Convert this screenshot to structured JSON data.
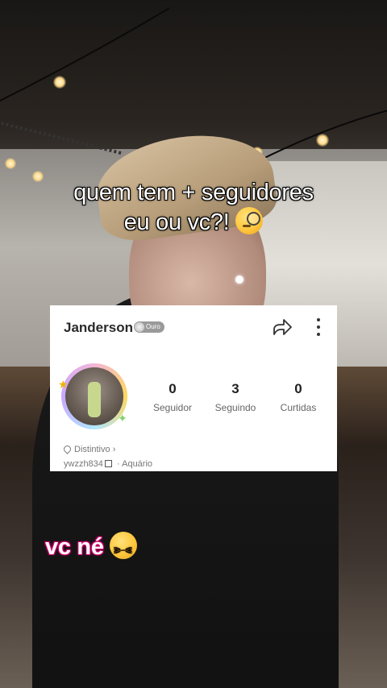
{
  "overlay": {
    "caption_top_line1": "quem tem + seguidores",
    "caption_top_line2": "eu ou vc?!",
    "caption_bottom": "vc né"
  },
  "profile": {
    "name": "Janderson",
    "badge_label": "Ouro",
    "stats": [
      {
        "value": "0",
        "label": "Seguidor"
      },
      {
        "value": "3",
        "label": "Seguindo"
      },
      {
        "value": "0",
        "label": "Curtidas"
      }
    ],
    "distintivo_label": "Distintivo",
    "distintivo_chevron": "›",
    "username": "ywzzh834",
    "separator": "·",
    "zodiac": "Aquário"
  },
  "icons": {
    "share": "share-arrow-icon",
    "more": "more-vertical-icon",
    "distintivo": "badge-pin-icon",
    "edit": "edit-icon",
    "emoji_top": "monocle-face-emoji",
    "emoji_bottom": "confounded-face-emoji"
  },
  "colors": {
    "card_bg": "#ffffff",
    "caption_text": "#ffffff",
    "badge_bg": "#9a9a9a"
  }
}
